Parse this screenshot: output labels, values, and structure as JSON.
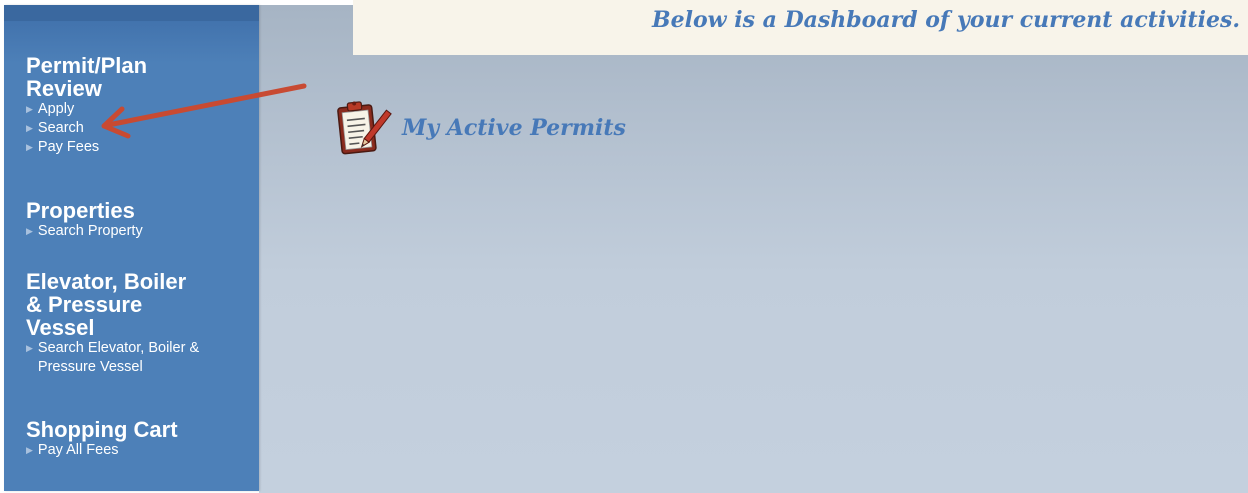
{
  "banner": {
    "text": "Below is a Dashboard of your current activities."
  },
  "sidebar": {
    "groups": [
      {
        "heading": "Permit/Plan\nReview",
        "links": [
          "Apply",
          "Search",
          "Pay Fees"
        ]
      },
      {
        "heading": "Properties",
        "links": [
          "Search Property"
        ]
      },
      {
        "heading": "Elevator, Boiler\n& Pressure\nVessel",
        "links": [
          "Search Elevator, Boiler &\nPressure Vessel"
        ]
      },
      {
        "heading": "Shopping Cart",
        "links": [
          "Pay All Fees"
        ]
      }
    ]
  },
  "main": {
    "section_title": "My Active Permits",
    "section_icon": "clipboard-icon"
  },
  "annotation": {
    "icon": "red-arrow-annotation",
    "color": "#c84a32"
  },
  "colors": {
    "sidebar": "#4d80b8",
    "accent_text": "#4779b8",
    "banner_bg": "#f8f4ea"
  }
}
